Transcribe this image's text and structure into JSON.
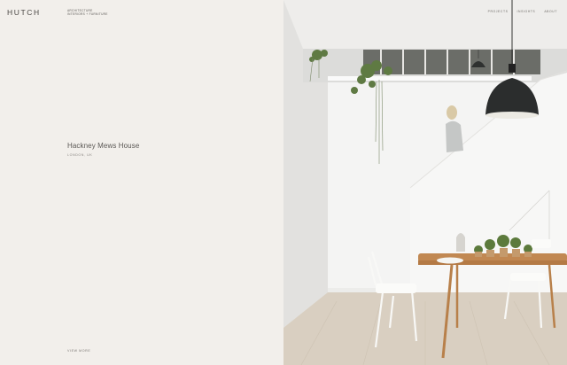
{
  "brand": {
    "logo": "HUTCH",
    "tagline": [
      "ARCHITECTURE",
      "INTERIORS + FURNITURE"
    ]
  },
  "project": {
    "title": "Hackney Mews House",
    "location": "LONDON, UK",
    "view_more": "VIEW MORE"
  },
  "nav": {
    "items": [
      {
        "label": "PROJECTS"
      },
      {
        "label": "INSIGHTS"
      },
      {
        "label": "ABOUT"
      }
    ]
  },
  "colors": {
    "panel_background": "#f2efeb",
    "text": "#5b5855"
  }
}
